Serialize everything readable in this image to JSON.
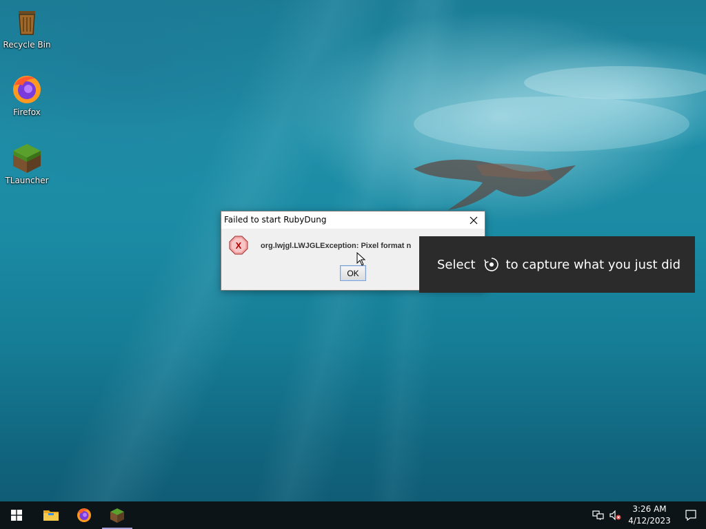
{
  "desktop": {
    "icons": [
      {
        "label": "Recycle Bin",
        "icon": "recycle-bin-icon"
      },
      {
        "label": "Firefox",
        "icon": "firefox-icon"
      },
      {
        "label": "TLauncher",
        "icon": "tlauncher-icon"
      }
    ]
  },
  "dialog": {
    "title": "Failed to start RubyDung",
    "message": "org.lwjgl.LWJGLException: Pixel format n",
    "ok_label": "OK",
    "icon": "error-icon"
  },
  "toast": {
    "text_before": "Select",
    "text_after": "to capture what you just did",
    "icon": "capture-icon"
  },
  "taskbar": {
    "items": [
      {
        "name": "start-button",
        "icon": "windows-logo-icon"
      },
      {
        "name": "file-explorer",
        "icon": "folder-icon"
      },
      {
        "name": "firefox",
        "icon": "firefox-icon"
      },
      {
        "name": "tlauncher",
        "icon": "tlauncher-icon",
        "active": true
      }
    ],
    "clock": {
      "time": "3:26 AM",
      "date": "4/12/2023"
    },
    "tray_icons": [
      "network-icon",
      "volume-muted-icon"
    ],
    "notification_icon": "notification-icon"
  },
  "colors": {
    "taskbar_bg": "#0c1418",
    "toast_bg": "#2b2b2b",
    "active_indicator": "#a6a0d8"
  }
}
